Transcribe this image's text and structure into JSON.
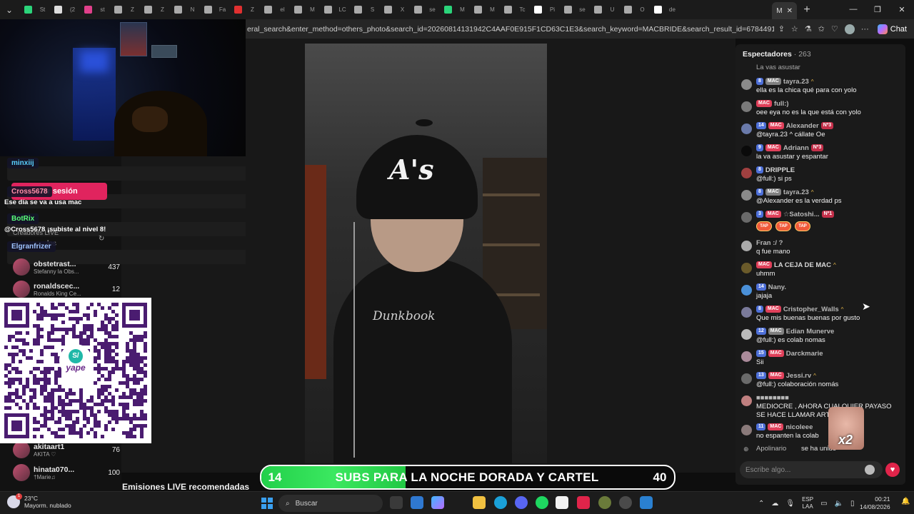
{
  "browser": {
    "url": "eral_search&enter_method=others_photo&search_id=20260814131942C4AAF0E915F1CD63C1E3&search_keyword=MACBRIDE&search_result_id=6784491877010916358...",
    "active_tab_label": "M",
    "chat_label": "Chat",
    "tab_labels": [
      "St",
      "(2",
      "st",
      "Z",
      "Z",
      "N",
      "Fa",
      "Z",
      "el",
      "M",
      "LC",
      "S",
      "X",
      "se",
      "M",
      "M",
      "Tc",
      "Pi",
      "se",
      "U",
      "O",
      "de"
    ]
  },
  "overlay": {
    "users": [
      {
        "name": "minxiij",
        "color": "#5ad0ff"
      },
      {
        "name": "Cross5678",
        "color": "#ff8fa8"
      },
      {
        "name": "BotRix",
        "color": "#5aff7a"
      },
      {
        "name": "Elgranfrizer",
        "color": "#9fc4ff"
      }
    ],
    "messages": [
      "Ese día se va a usa mac",
      "@Cross5678 ¡subiste al nivel 8!"
    ]
  },
  "sidebar": {
    "login_label": "Iniciar sesión",
    "login_visible": "iar sesión",
    "creators_label": "Creadores LIVE",
    "partial_text": "los",
    "suggestions": [
      {
        "name": "obstetrast...",
        "sub": "Stefanny la Obs...",
        "count": "437"
      },
      {
        "name": "ronaldscec...",
        "sub": "Ronalds King Ce...",
        "count": "12"
      },
      {
        "name": "akitaart1",
        "sub": "AKITA ♡",
        "count": "76"
      },
      {
        "name": "hinata070...",
        "sub": "†Marie♫",
        "count": "100"
      }
    ]
  },
  "qr": {
    "brand": "yape"
  },
  "main": {
    "recommended_label": "Emisiones LIVE recomendadas"
  },
  "banner": {
    "left": "14",
    "text": "SUBS PARA LA NOCHE DORADA Y CARTEL",
    "right": "40",
    "progress": 0.35
  },
  "chat": {
    "viewers_label": "Espectadores",
    "viewers_count": "· 263",
    "placeholder": "Escribe algo...",
    "top_partial": "La vas asustar",
    "messages": [
      {
        "lvl": "8",
        "tag": "MAC",
        "name": "tayra.23",
        "extra": "^",
        "text": "ella es la chica qué para con yolo"
      },
      {
        "lvl": "",
        "tag": "MAC",
        "name": "full:)",
        "extra": "",
        "text": "oee eya no es la que está con yolo"
      },
      {
        "lvl": "14",
        "tag": "MAC",
        "name": "Alexander",
        "extra": "Nº3",
        "text": "@tayra.23 ^ cállate Oe"
      },
      {
        "lvl": "9",
        "tag": "MAC",
        "name": "Adriann",
        "extra": "Nº3",
        "text": "la va asustar y espantar"
      },
      {
        "lvl": "8",
        "tag": "",
        "name": "DRIPPLE",
        "extra": "",
        "text": "@full:) si ps"
      },
      {
        "lvl": "8",
        "tag": "MAC",
        "name": "tayra.23",
        "extra": "^",
        "text": "@Alexander es la verdad ps"
      },
      {
        "lvl": "3",
        "tag": "MAC",
        "name": "☆Satoshi...",
        "extra": "Nº1",
        "text": ""
      },
      {
        "lvl": "",
        "tag": "",
        "name": "Fran :/ ?",
        "extra": "",
        "text": "q fue mano"
      },
      {
        "lvl": "",
        "tag": "MAC",
        "name": "LA CEJA DE MAC",
        "extra": "^",
        "text": "uhmm"
      },
      {
        "lvl": "14",
        "tag": "",
        "name": "Nany.",
        "extra": "",
        "text": "jajaja"
      },
      {
        "lvl": "8",
        "tag": "MAC",
        "name": "Cristopher_Walls",
        "extra": "^",
        "text": "Que mis buenas buenas por gusto"
      },
      {
        "lvl": "12",
        "tag": "MAC",
        "name": "Edian Munerve",
        "extra": "",
        "text": "@full:) es colab nomas"
      },
      {
        "lvl": "15",
        "tag": "MAC",
        "name": "Darckmarie",
        "extra": "",
        "text": "Sii"
      },
      {
        "lvl": "13",
        "tag": "MAC",
        "name": "Jessi.rv",
        "extra": "^",
        "text": "@full:) colaboración nomás"
      },
      {
        "lvl": "",
        "tag": "",
        "name": "■■■■■■■■",
        "extra": "",
        "text": "MEDIOCRE , AHORA CUALQUIER PAYASO"
      },
      {
        "lvl": "11",
        "tag": "MAC",
        "name": "nicoleee",
        "extra": "",
        "text": "no espanten la colab"
      }
    ],
    "msg14_line2": "SE HACE LLAMAR ARTIS",
    "tap_label": "TAP",
    "joined": {
      "name": "Apolinario",
      "text": "se ha unido"
    },
    "gift_multiplier": "x2"
  },
  "taskbar": {
    "temp": "23°C",
    "weather": "Mayorm. nublado",
    "search_label": "Buscar",
    "lang1": "ESP",
    "lang2": "LAA",
    "time": "00:21",
    "date": "14/08/2026"
  }
}
